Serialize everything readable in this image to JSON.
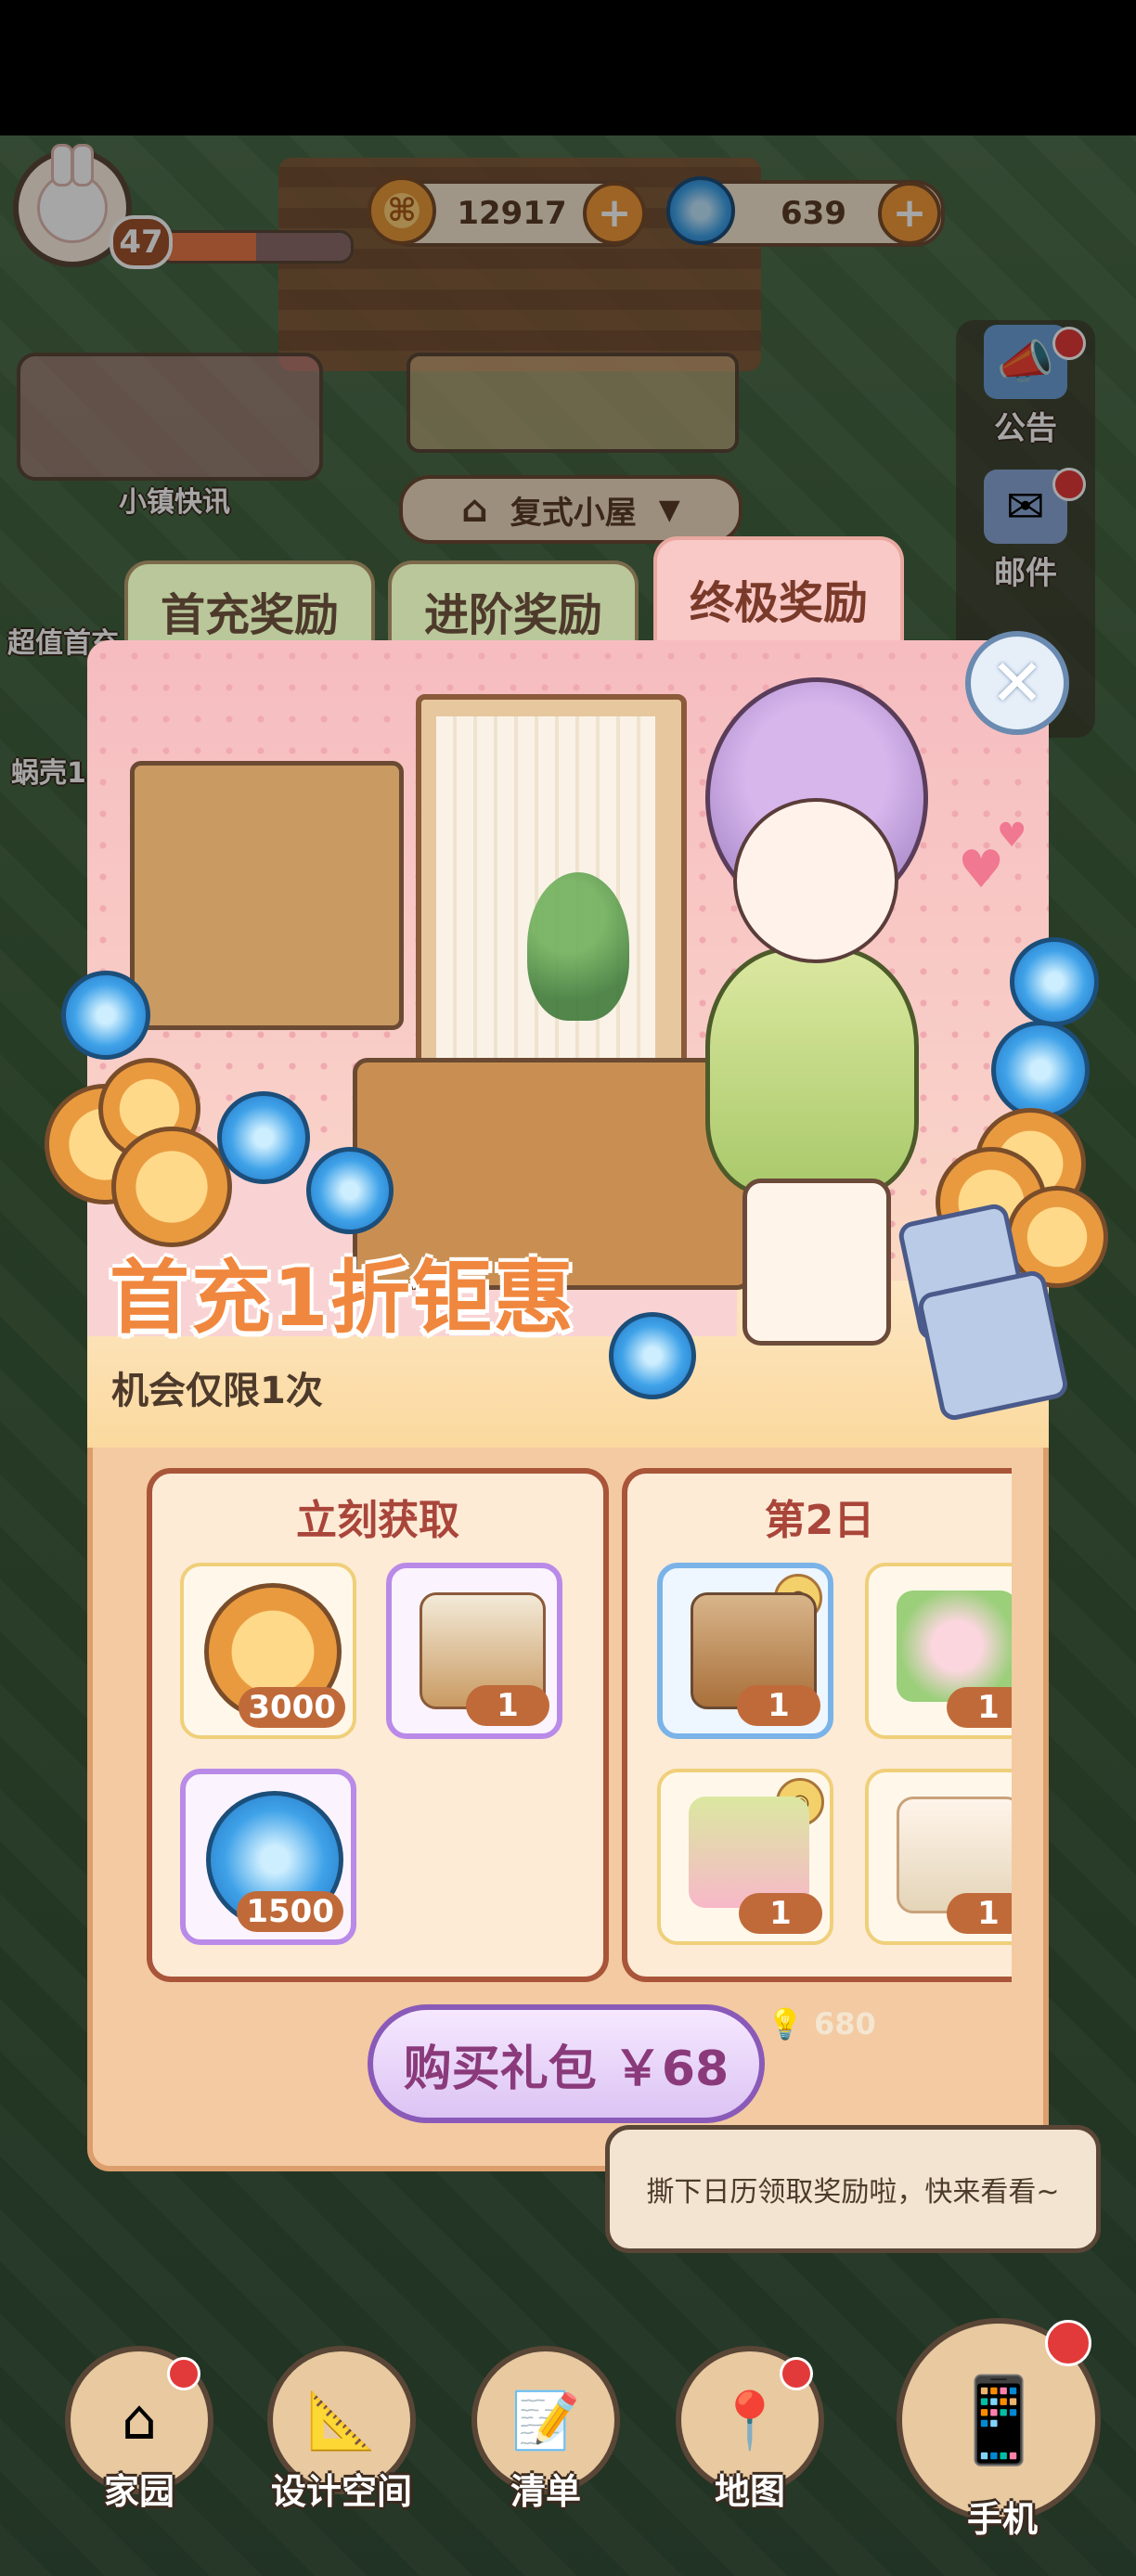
{
  "hud": {
    "level": "47",
    "xp_fraction": 0.5,
    "coins": "12917",
    "gems": "639",
    "coin_glyph": "⌘",
    "plus": "+"
  },
  "left_panel": {
    "news_label": "小镇快讯",
    "deal_label": "超值首充",
    "snail_label": "蜗壳1"
  },
  "location": {
    "house_name": "复式小屋",
    "dropdown_icon": "triangle-down-icon"
  },
  "right_menu": {
    "notice_label": "公告",
    "mail_label": "邮件"
  },
  "tabs": [
    {
      "label": "首充奖励",
      "active": false
    },
    {
      "label": "进阶奖励",
      "active": false
    },
    {
      "label": "终极奖励",
      "active": true
    }
  ],
  "banner": {
    "title": "首充1折钜惠",
    "subtitle": "机会仅限1次",
    "close_glyph": "✕"
  },
  "rewards": {
    "now": {
      "header": "立刻获取",
      "items": [
        {
          "kind": "coin",
          "count": "3000"
        },
        {
          "kind": "furniture-screen",
          "count": "1"
        },
        {
          "kind": "gem",
          "count": "1500"
        }
      ]
    },
    "day2": {
      "header": "第2日",
      "items": [
        {
          "kind": "furniture-shelf",
          "count": "1"
        },
        {
          "kind": "hair-ornament",
          "count": "1"
        },
        {
          "kind": "dress",
          "count": "1"
        },
        {
          "kind": "boots",
          "count": "1"
        }
      ]
    }
  },
  "purchase": {
    "button_label": "购买礼包 ￥68",
    "bonus": "680"
  },
  "tooltip": {
    "text": "撕下日历领取奖励啦，快来看看~"
  },
  "nav": [
    {
      "label": "家园",
      "icon": "home-icon"
    },
    {
      "label": "设计空间",
      "icon": "design-icon"
    },
    {
      "label": "清单",
      "icon": "list-icon"
    },
    {
      "label": "地图",
      "icon": "map-pin-icon"
    },
    {
      "label": "手机",
      "icon": "phone-icon"
    }
  ],
  "colors": {
    "accent_orange": "#f0873e",
    "tab_active": "#f8c9c6",
    "tab_inactive": "#b9c79a",
    "panel_border": "#a9553a"
  }
}
